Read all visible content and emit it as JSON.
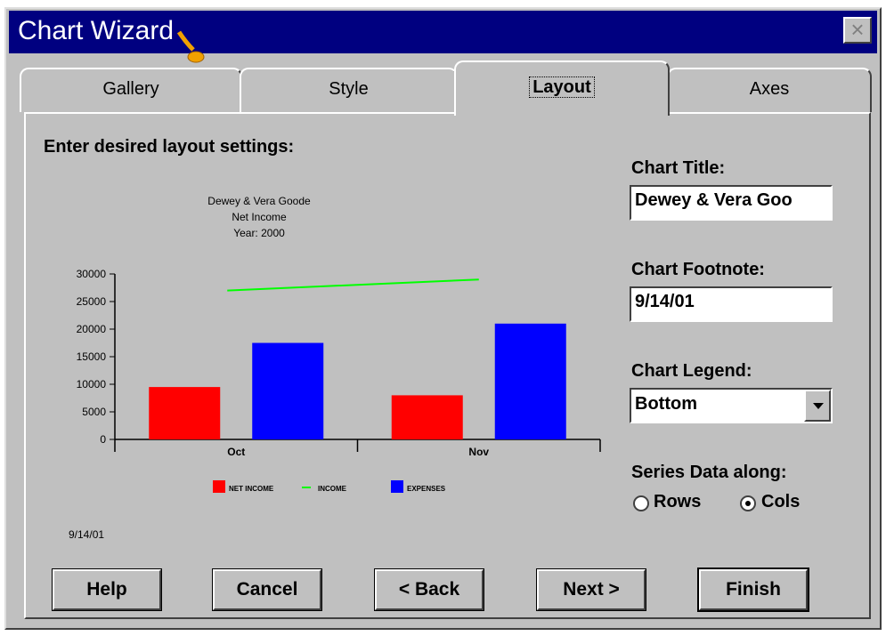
{
  "window": {
    "title": "Chart Wizard",
    "close_glyph": "×"
  },
  "tabs": [
    {
      "label": "Gallery"
    },
    {
      "label": "Style"
    },
    {
      "label": "Layout"
    },
    {
      "label": "Axes"
    }
  ],
  "active_tab": "Layout",
  "prompt": "Enter desired layout settings:",
  "fields": {
    "chart_title_label": "Chart Title:",
    "chart_title_value": "Dewey & Vera Goo",
    "chart_footnote_label": "Chart Footnote:",
    "chart_footnote_value": "9/14/01",
    "chart_legend_label": "Chart Legend:",
    "chart_legend_value": "Bottom",
    "series_label": "Series Data along:",
    "rows_label": "Rows",
    "cols_label": "Cols",
    "series_selected": "Cols"
  },
  "buttons": {
    "help": "Help",
    "cancel": "Cancel",
    "back": "< Back",
    "next": "Next >",
    "finish": "Finish"
  },
  "colors": {
    "titlebar": "#000080",
    "net_income": "#ff0000",
    "income": "#00ff00",
    "expenses": "#0000ff"
  },
  "chart_data": {
    "type": "bar",
    "title_lines": [
      "Dewey & Vera Goode",
      "Net Income",
      "Year: 2000"
    ],
    "footnote": "9/14/01",
    "categories": [
      "Oct",
      "Nov"
    ],
    "yticks": [
      0,
      5000,
      10000,
      15000,
      20000,
      25000,
      30000
    ],
    "ylim": [
      0,
      30000
    ],
    "series": [
      {
        "name": "NET INCOME",
        "type": "bar",
        "color": "#ff0000",
        "values": [
          9500,
          8000
        ]
      },
      {
        "name": "INCOME",
        "type": "line",
        "color": "#00ff00",
        "values": [
          27000,
          29000
        ]
      },
      {
        "name": "EXPENSES",
        "type": "bar",
        "color": "#0000ff",
        "values": [
          17500,
          21000
        ]
      }
    ],
    "legend_position": "bottom"
  }
}
